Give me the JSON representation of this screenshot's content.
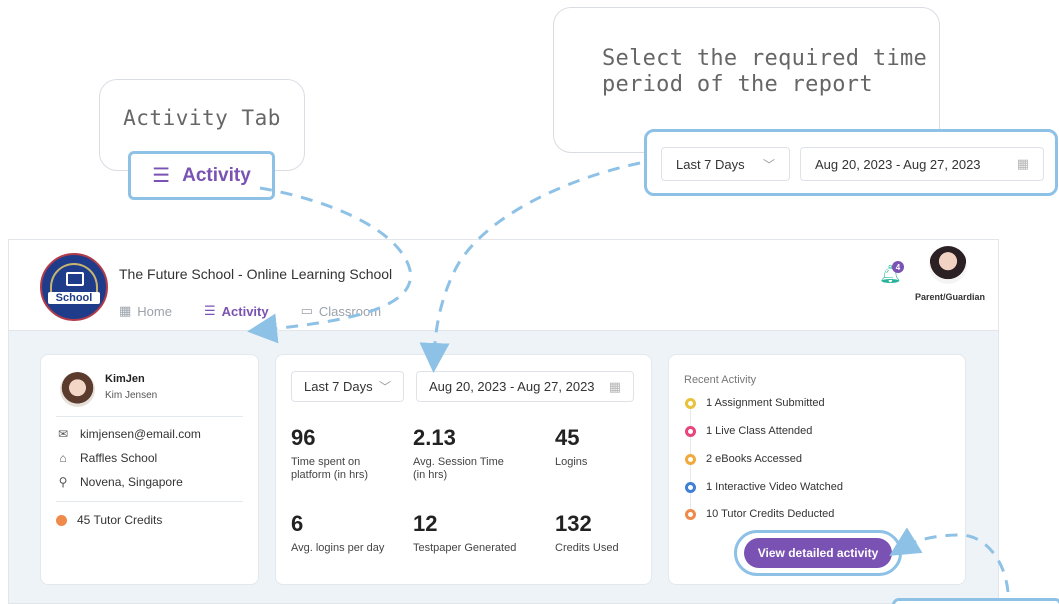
{
  "callouts": {
    "activity_tab": "Activity Tab",
    "time_period": "Select the required time\nperiod of the report"
  },
  "highlight": {
    "activity_label": "Activity",
    "period_select": "Last 7 Days",
    "date_range": "Aug 20, 2023 - Aug 27, 2023"
  },
  "header": {
    "school_name": "The Future School - Online Learning School",
    "logo_text": "School",
    "nav": [
      {
        "label": "Home",
        "icon": "grid-icon",
        "active": false
      },
      {
        "label": "Activity",
        "icon": "list-icon",
        "active": true
      },
      {
        "label": "Classroom",
        "icon": "screen-icon",
        "active": false
      }
    ],
    "notifications_count": "4",
    "role_label": "Parent/Guardian"
  },
  "profile": {
    "username": "KimJen",
    "full_name": "Kim Jensen",
    "email": "kimjensen@email.com",
    "school": "Raffles School",
    "location": "Novena, Singapore",
    "credits": "45 Tutor Credits"
  },
  "filters": {
    "period": "Last 7 Days",
    "date_range": "Aug 20, 2023 - Aug 27, 2023"
  },
  "stats": [
    {
      "value": "96",
      "label": "Time spent on platform (in hrs)"
    },
    {
      "value": "2.13",
      "label": "Avg. Session Time (in hrs)"
    },
    {
      "value": "45",
      "label": "Logins"
    },
    {
      "value": "6",
      "label": "Avg. logins per day"
    },
    {
      "value": "12",
      "label": "Testpaper Generated"
    },
    {
      "value": "132",
      "label": "Credits Used"
    }
  ],
  "recent": {
    "title": "Recent Activity",
    "items": [
      {
        "label": "1 Assignment Submitted",
        "color": "#e7c23a"
      },
      {
        "label": "1 Live Class Attended",
        "color": "#e8457a"
      },
      {
        "label": "2 eBooks Accessed",
        "color": "#f2a93b"
      },
      {
        "label": "1 Interactive Video Watched",
        "color": "#3f7fd6"
      },
      {
        "label": "10 Tutor Credits Deducted",
        "color": "#f08a4b"
      }
    ],
    "button": "View detailed activity"
  },
  "colors": {
    "accent": "#7a52b3",
    "highlight": "#8ec1e6"
  }
}
